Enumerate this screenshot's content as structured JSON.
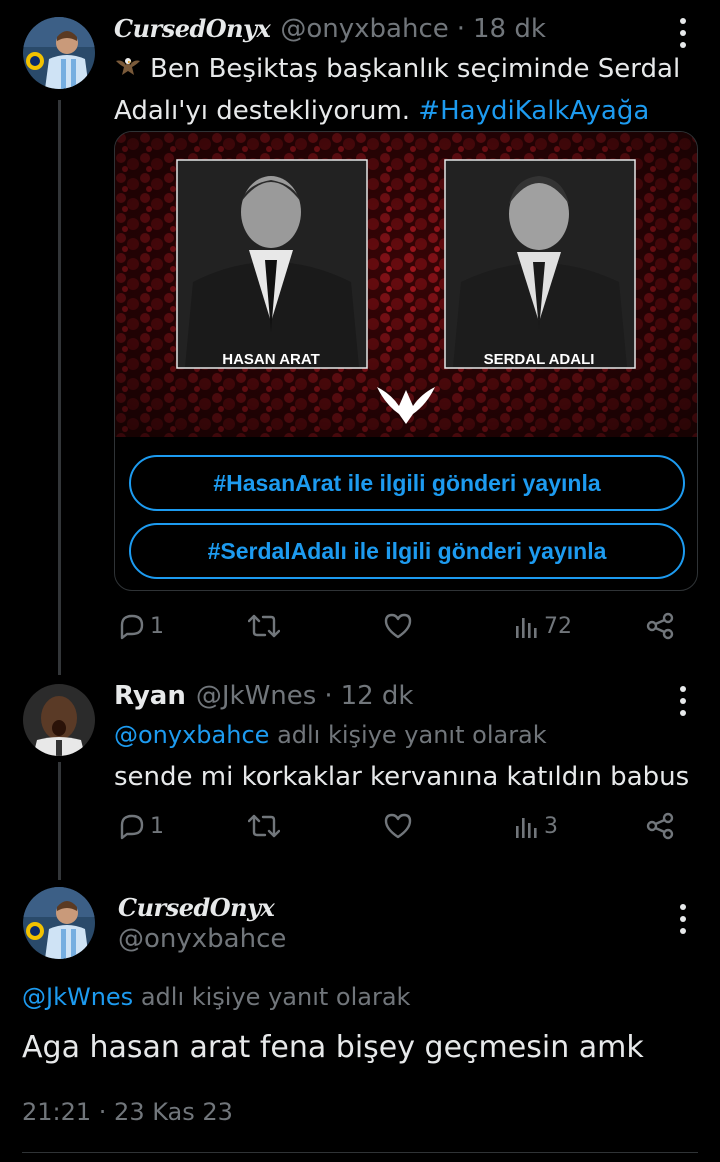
{
  "tweet1": {
    "display_name": "CursedOnyx",
    "handle": "@onyxbahce",
    "separator": "·",
    "time": "18 dk",
    "text_line1": "Ben Beşiktaş başkanlık seçiminde Serdal",
    "text_line2": "Adalı'yı destekliyorum.",
    "hashtag": "#HaydiKalkAyağa",
    "card": {
      "candidate_left": "HASAN ARAT",
      "candidate_right": "SERDAL ADALI",
      "option1": "#HasanArat ile ilgili gönderi yayınla",
      "option2": "#SerdalAdalı ile ilgili gönderi yayınla"
    },
    "replies": "1",
    "views": "72"
  },
  "tweet2": {
    "display_name": "Ryan",
    "handle": "@JkWnes",
    "separator": "·",
    "time": "12 dk",
    "reply_to_handle": "@onyxbahce",
    "reply_to_suffix": "adlı kişiye yanıt olarak",
    "text": "sende mi korkaklar kervanına katıldın babus",
    "replies": "1",
    "views": "3"
  },
  "main_tweet": {
    "display_name": "CursedOnyx",
    "handle": "@onyxbahce",
    "reply_to_handle": "@JkWnes",
    "reply_to_suffix": "adlı kişiye yanıt olarak",
    "text": "Aga hasan arat fena bişey geçmesin amk",
    "timestamp": "21:21 · 23 Kas 23"
  },
  "colors": {
    "background": "#000000",
    "accent": "#1d9bf0",
    "muted": "#71767b",
    "text": "#e7e9ea",
    "card_red": "#7a0d12"
  },
  "icons": [
    "eagle-emoji-icon",
    "reply-icon",
    "retweet-icon",
    "like-icon",
    "views-icon",
    "share-icon",
    "more-icon",
    "eagle-logo-icon"
  ]
}
